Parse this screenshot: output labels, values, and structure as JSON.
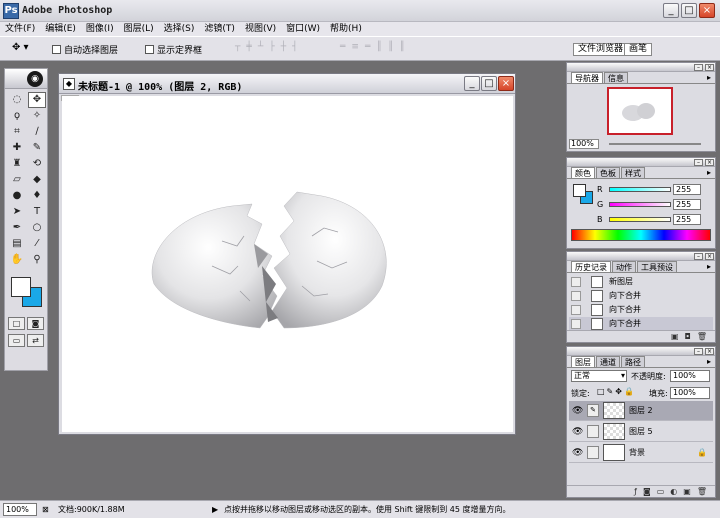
{
  "app": {
    "title": "Adobe Photoshop",
    "icon": "photoshop-icon"
  },
  "menu": [
    "文件(F)",
    "编辑(E)",
    "图像(I)",
    "图层(L)",
    "选择(S)",
    "滤镜(T)",
    "视图(V)",
    "窗口(W)",
    "帮助(H)"
  ],
  "options": {
    "tool_preset_icon": "move-tool-icon",
    "auto_select_label": "自动选择图层",
    "show_bounds_label": "显示定界框",
    "file_browser_label": "文件浏览器",
    "brushes_label": "画笔"
  },
  "toolbox": {
    "tools": [
      [
        "marquee-icon",
        "move-icon"
      ],
      [
        "lasso-icon",
        "magic-wand-icon"
      ],
      [
        "crop-icon",
        "slice-icon"
      ],
      [
        "healing-brush-icon",
        "brush-icon"
      ],
      [
        "clone-stamp-icon",
        "history-brush-icon"
      ],
      [
        "eraser-icon",
        "paint-bucket-icon"
      ],
      [
        "blur-icon",
        "dodge-icon"
      ],
      [
        "path-select-icon",
        "type-icon"
      ],
      [
        "pen-icon",
        "shape-icon"
      ],
      [
        "notes-icon",
        "eyedropper-icon"
      ],
      [
        "hand-icon",
        "zoom-icon"
      ]
    ],
    "fg_color": "#ffffff",
    "bg_color": "#1aa8e8"
  },
  "document": {
    "title": "未标题-1 @ 100% (图层 2, RGB)"
  },
  "navigator": {
    "tabs": [
      "导航器",
      "信息"
    ],
    "zoom": "100%"
  },
  "color_panel": {
    "tabs": [
      "颜色",
      "色板",
      "样式"
    ],
    "channels": [
      {
        "label": "R",
        "value": "255",
        "grad": "linear-gradient(90deg,#00ffff,#ffffff)"
      },
      {
        "label": "G",
        "value": "255",
        "grad": "linear-gradient(90deg,#ff00ff,#ffffff)"
      },
      {
        "label": "B",
        "value": "255",
        "grad": "linear-gradient(90deg,#ffff00,#ffffff)"
      }
    ]
  },
  "history": {
    "tabs": [
      "历史记录",
      "动作",
      "工具预设"
    ],
    "items": [
      "新图层",
      "向下合并",
      "向下合并",
      "向下合并"
    ]
  },
  "layers": {
    "tabs": [
      "图层",
      "通道",
      "路径"
    ],
    "blend_mode": "正常",
    "opacity_label": "不透明度:",
    "opacity": "100%",
    "lock_label": "锁定:",
    "fill_label": "填充:",
    "fill": "100%",
    "items": [
      {
        "name": "图层 2",
        "selected": true,
        "locked": false,
        "transparent": true
      },
      {
        "name": "图层 5",
        "selected": false,
        "locked": false,
        "transparent": true
      },
      {
        "name": "背景",
        "selected": false,
        "locked": true,
        "transparent": false
      }
    ]
  },
  "status": {
    "zoom": "100%",
    "doc_size": "文档:900K/1.88M",
    "hint": "点按并拖移以移动图层或移动选区的副本。使用 Shift 键限制到 45 度增量方向。"
  }
}
